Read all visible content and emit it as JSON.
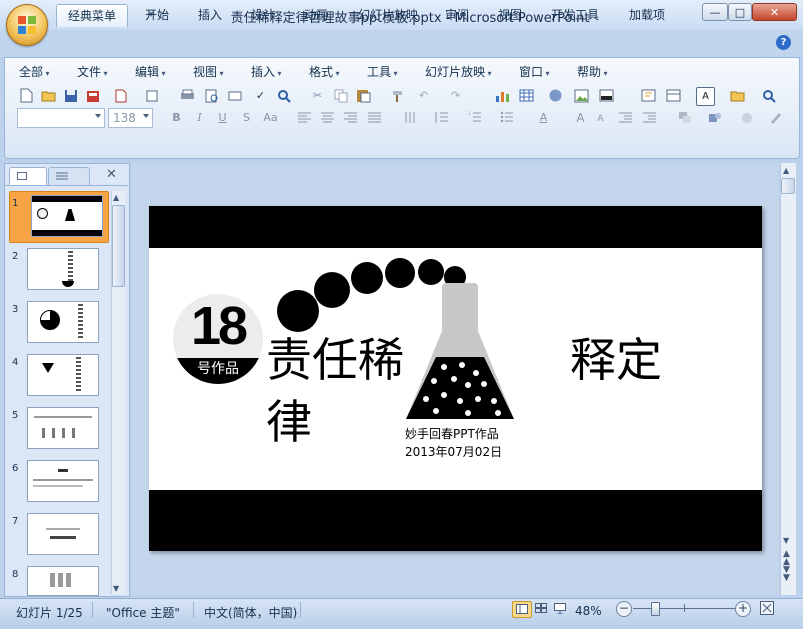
{
  "window": {
    "title": "责任稀释定律哲理故事ppt模板.pptx - Microsoft PowerPoint",
    "min_label": "—",
    "max_label": "□",
    "close_label": "✕"
  },
  "tabs": [
    "经典菜单",
    "开始",
    "插入",
    "设计",
    "动画",
    "幻灯片放映",
    "审阅",
    "视图",
    "开发工具",
    "加载项"
  ],
  "active_tab": "经典菜单",
  "menu": [
    "全部",
    "文件",
    "编辑",
    "视图",
    "插入",
    "格式",
    "工具",
    "幻灯片放映",
    "窗口",
    "帮助"
  ],
  "font_size_value": "138",
  "font_name_value": "",
  "slide_panel": {
    "slides": [
      "1",
      "2",
      "3",
      "4",
      "5",
      "6",
      "7",
      "8"
    ],
    "selected": "1"
  },
  "slide": {
    "badge_number": "18",
    "badge_caption": "号作品",
    "title_part1": "责任稀",
    "title_part2": "律",
    "title_part3": "释定",
    "author": "妙手回春PPT作品",
    "date": "2013年07月02日"
  },
  "status": {
    "slide_info": "幻灯片 1/25",
    "theme": "\"Office 主题\"",
    "language": "中文(简体，中国)",
    "zoom": "48%"
  },
  "colors": {
    "accent": "#2c6bc7",
    "slide_band": "#000000",
    "thumb_selected": "#f7a544"
  }
}
